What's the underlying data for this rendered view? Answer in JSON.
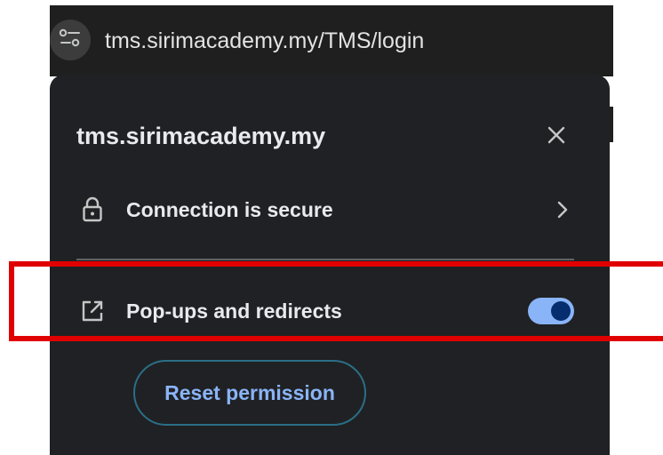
{
  "addressbar": {
    "url": "tms.sirimacademy.my/TMS/login",
    "site_settings_icon": "tune-icon"
  },
  "popup": {
    "title": "tms.sirimacademy.my",
    "close_icon": "close-icon",
    "connection": {
      "label": "Connection is secure",
      "icon": "lock-icon",
      "chevron_icon": "chevron-right-icon"
    },
    "popups_redirects": {
      "label": "Pop-ups and redirects",
      "icon": "open-in-new-icon",
      "toggle_on": true
    },
    "reset_label": "Reset permission"
  },
  "colors": {
    "panel_bg": "#202124",
    "text": "#e8eaed",
    "accent": "#8ab4f8",
    "highlight": "#e00000"
  }
}
